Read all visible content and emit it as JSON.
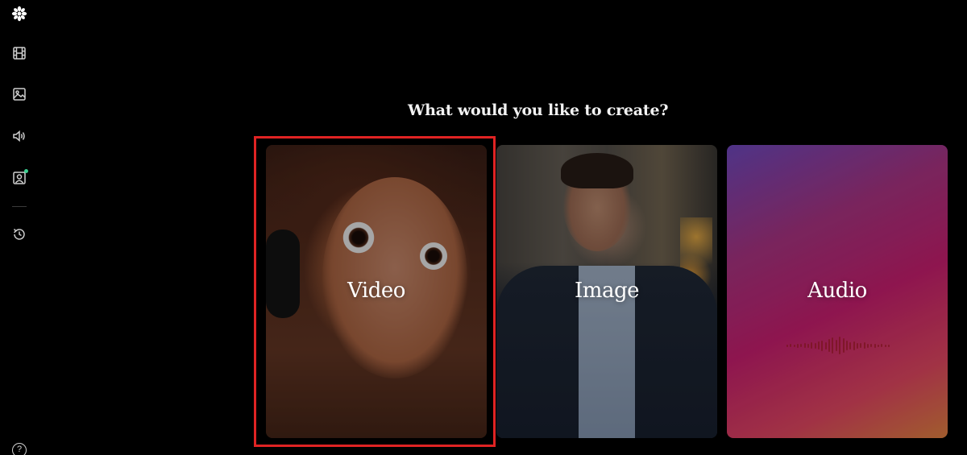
{
  "heading": "What would you like to create?",
  "sidebar": {
    "items": [
      {
        "icon": "logo-icon"
      },
      {
        "icon": "film-icon"
      },
      {
        "icon": "image-icon"
      },
      {
        "icon": "speaker-icon"
      },
      {
        "icon": "avatar-icon",
        "badge_color": "#3ccf91"
      },
      {
        "icon": "history-icon"
      }
    ],
    "help_label": "?"
  },
  "cards": [
    {
      "label": "Video"
    },
    {
      "label": "Image"
    },
    {
      "label": "Audio"
    }
  ],
  "colors": {
    "background": "#000000",
    "highlight": "#e02323",
    "badge": "#3ccf91"
  }
}
